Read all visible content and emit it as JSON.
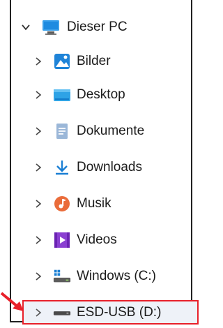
{
  "tree": {
    "root": {
      "label": "Dieser PC",
      "icon": "monitor-icon",
      "expanded": true
    },
    "items": [
      {
        "label": "Bilder",
        "icon": "pictures-icon"
      },
      {
        "label": "Desktop",
        "icon": "desktop-folder-icon"
      },
      {
        "label": "Dokumente",
        "icon": "documents-icon"
      },
      {
        "label": "Downloads",
        "icon": "download-arrow-icon"
      },
      {
        "label": "Musik",
        "icon": "music-icon"
      },
      {
        "label": "Videos",
        "icon": "videos-icon"
      },
      {
        "label": "Windows (C:)",
        "icon": "windows-drive-icon"
      },
      {
        "label": "ESD-USB (D:)",
        "icon": "usb-drive-icon",
        "highlighted": true
      }
    ]
  },
  "colors": {
    "highlight_border": "#e8202a",
    "arrow": "#e8202a",
    "accent_blue": "#0b78d4"
  }
}
